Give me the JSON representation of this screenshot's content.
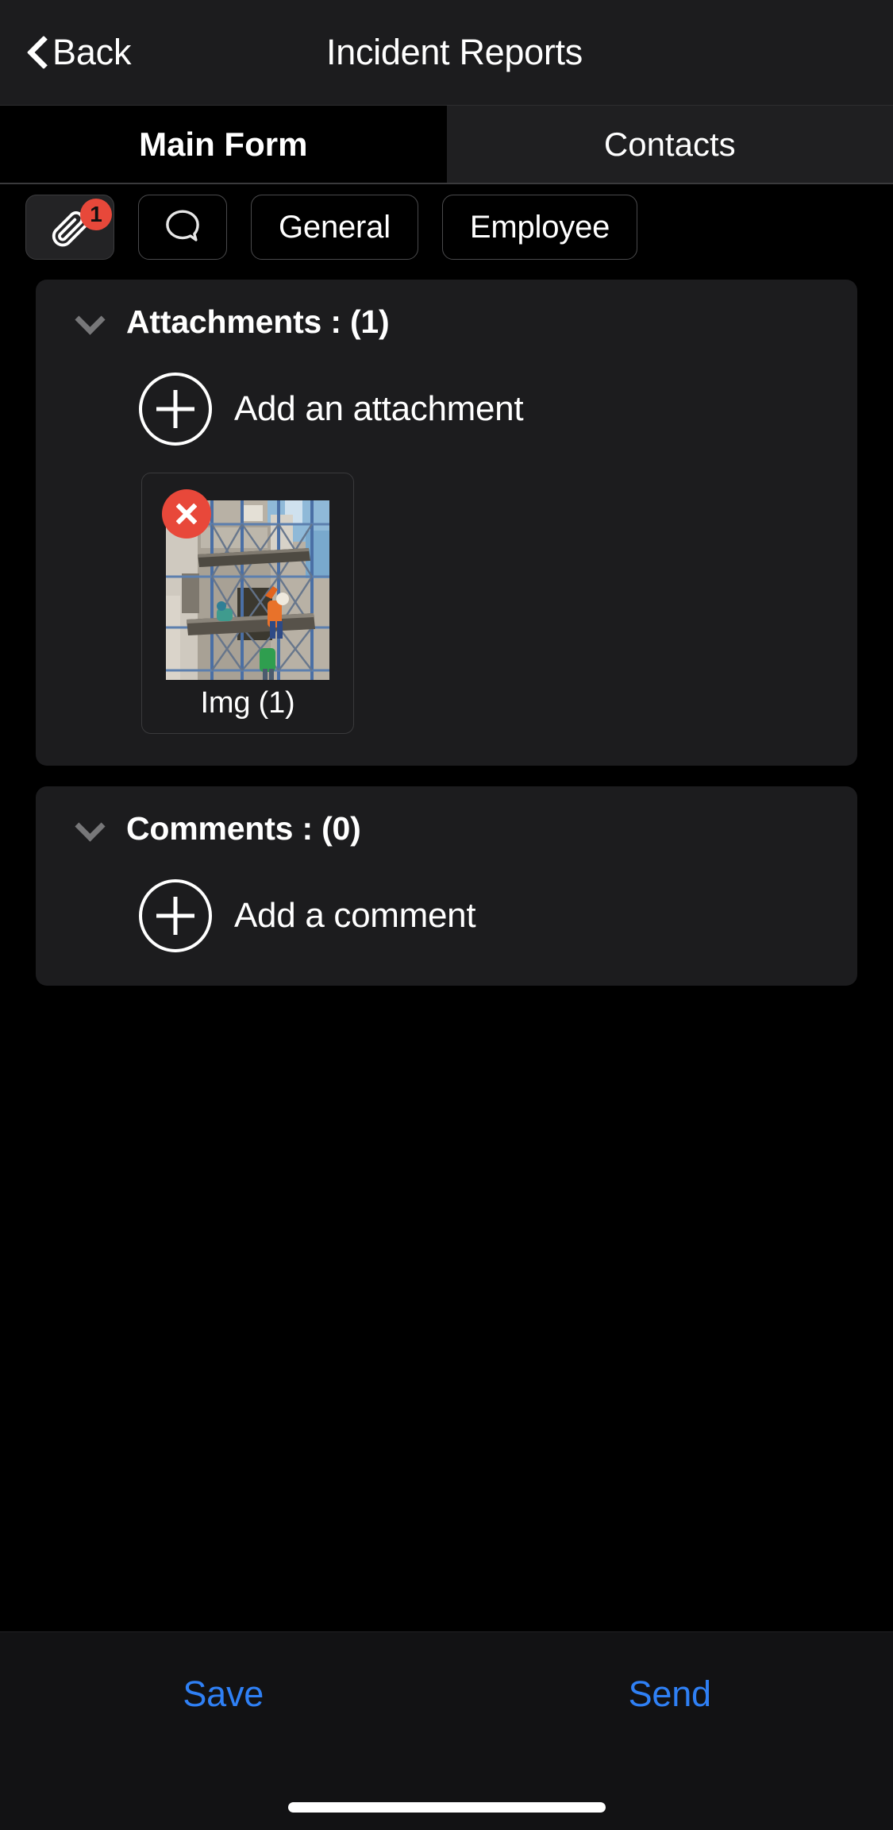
{
  "navbar": {
    "back_label": "Back",
    "title": "Incident Reports",
    "back_icon": "chevron-left-icon"
  },
  "tabs": [
    {
      "label": "Main Form",
      "active": true
    },
    {
      "label": "Contacts",
      "active": false
    }
  ],
  "chips": [
    {
      "type": "icon",
      "icon": "paperclip-icon",
      "badge": "1",
      "selected": true
    },
    {
      "type": "icon",
      "icon": "speech-bubble-icon",
      "badge": null,
      "selected": false
    },
    {
      "type": "text",
      "label": "General",
      "selected": false
    },
    {
      "type": "text",
      "label": "Employee",
      "selected": false
    }
  ],
  "attachments_section": {
    "title": "Attachments : (1)",
    "collapse_icon": "chevron-down-icon",
    "add_label": "Add an attachment",
    "add_icon": "plus-circle-icon",
    "items": [
      {
        "caption": "Img (1)",
        "delete_icon": "close-circle-icon",
        "image_alt": "construction scaffolding with workers"
      }
    ]
  },
  "comments_section": {
    "title": "Comments : (0)",
    "collapse_icon": "chevron-down-icon",
    "add_label": "Add a comment",
    "add_icon": "plus-circle-icon"
  },
  "bottombar": {
    "save_label": "Save",
    "send_label": "Send"
  },
  "colors": {
    "badge_red": "#e8483a",
    "action_blue": "#2f80f5",
    "card_bg": "#1c1c1e",
    "page_bg": "#000000"
  }
}
